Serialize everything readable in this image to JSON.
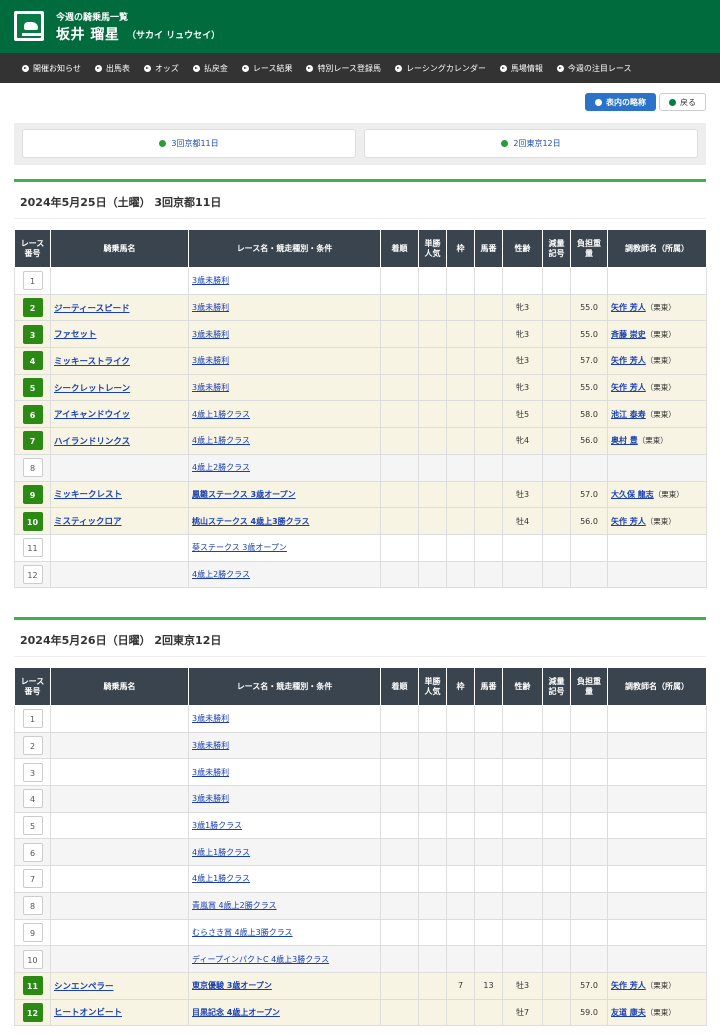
{
  "header": {
    "subtitle": "今週の騎乗馬一覧",
    "jockey_name": "坂井 瑠星",
    "jockey_kana": "（サカイ リュウセイ）"
  },
  "nav": [
    {
      "label": "開催お知らせ"
    },
    {
      "label": "出馬表"
    },
    {
      "label": "オッズ"
    },
    {
      "label": "払戻金"
    },
    {
      "label": "レース結果"
    },
    {
      "label": "特別レース登録馬"
    },
    {
      "label": "レーシングカレンダー"
    },
    {
      "label": "馬場情報"
    },
    {
      "label": "今週の注目レース"
    }
  ],
  "actions": {
    "abbr_label": "表内の略称",
    "back_label": "戻る"
  },
  "venues": [
    {
      "label": "3回京都11日"
    },
    {
      "label": "2回東京12日"
    }
  ],
  "columns": {
    "race_no": "レース番号",
    "horse": "騎乗馬名",
    "race": "レース名・競走種別・条件",
    "finish": "着順",
    "popularity": "単勝人気",
    "frame": "枠",
    "number": "馬番",
    "sexage": "性齢",
    "reduction": "減量記号",
    "weight": "負担重量",
    "trainer": "調教師名（所属）"
  },
  "days": [
    {
      "title": "2024年5月25日（土曜） 3回京都11日",
      "races": [
        {
          "no": "1",
          "horse": "",
          "race": "3歳未勝利",
          "finish": "",
          "pop": "",
          "frame": "",
          "num": "",
          "sexage": "",
          "red": "",
          "weight": "",
          "trainer": "",
          "aff": ""
        },
        {
          "no": "2",
          "horse": "ジーティースピード",
          "race": "3歳未勝利",
          "finish": "",
          "pop": "",
          "frame": "",
          "num": "",
          "sexage": "牝3",
          "red": "",
          "weight": "55.0",
          "trainer": "矢作 芳人",
          "aff": "（栗東）"
        },
        {
          "no": "3",
          "horse": "ファセット",
          "race": "3歳未勝利",
          "finish": "",
          "pop": "",
          "frame": "",
          "num": "",
          "sexage": "牝3",
          "red": "",
          "weight": "55.0",
          "trainer": "斉藤 崇史",
          "aff": "（栗東）"
        },
        {
          "no": "4",
          "horse": "ミッキーストライク",
          "race": "3歳未勝利",
          "finish": "",
          "pop": "",
          "frame": "",
          "num": "",
          "sexage": "牡3",
          "red": "",
          "weight": "57.0",
          "trainer": "矢作 芳人",
          "aff": "（栗東）"
        },
        {
          "no": "5",
          "horse": "シークレットレーン",
          "race": "3歳未勝利",
          "finish": "",
          "pop": "",
          "frame": "",
          "num": "",
          "sexage": "牝3",
          "red": "",
          "weight": "55.0",
          "trainer": "矢作 芳人",
          "aff": "（栗東）"
        },
        {
          "no": "6",
          "horse": "アイキャンドウイッ",
          "race": "4歳上1勝クラス",
          "finish": "",
          "pop": "",
          "frame": "",
          "num": "",
          "sexage": "牡5",
          "red": "",
          "weight": "58.0",
          "trainer": "池江 泰寿",
          "aff": "（栗東）"
        },
        {
          "no": "7",
          "horse": "ハイランドリンクス",
          "race": "4歳上1勝クラス",
          "finish": "",
          "pop": "",
          "frame": "",
          "num": "",
          "sexage": "牝4",
          "red": "",
          "weight": "56.0",
          "trainer": "奥村 豊",
          "aff": "（栗東）"
        },
        {
          "no": "8",
          "horse": "",
          "race": "4歳上2勝クラス",
          "finish": "",
          "pop": "",
          "frame": "",
          "num": "",
          "sexage": "",
          "red": "",
          "weight": "",
          "trainer": "",
          "aff": ""
        },
        {
          "no": "9",
          "horse": "ミッキークレスト",
          "race": "鳳雛ステークス 3歳オープン",
          "finish": "",
          "pop": "",
          "frame": "",
          "num": "",
          "sexage": "牡3",
          "red": "",
          "weight": "57.0",
          "trainer": "大久保 龍志",
          "aff": "（栗東）"
        },
        {
          "no": "10",
          "horse": "ミスティックロア",
          "race": "桃山ステークス 4歳上3勝クラス",
          "finish": "",
          "pop": "",
          "frame": "",
          "num": "",
          "sexage": "牡4",
          "red": "",
          "weight": "56.0",
          "trainer": "矢作 芳人",
          "aff": "（栗東）"
        },
        {
          "no": "11",
          "horse": "",
          "race": "葵ステークス 3歳オープン",
          "finish": "",
          "pop": "",
          "frame": "",
          "num": "",
          "sexage": "",
          "red": "",
          "weight": "",
          "trainer": "",
          "aff": ""
        },
        {
          "no": "12",
          "horse": "",
          "race": "4歳上2勝クラス",
          "finish": "",
          "pop": "",
          "frame": "",
          "num": "",
          "sexage": "",
          "red": "",
          "weight": "",
          "trainer": "",
          "aff": ""
        }
      ]
    },
    {
      "title": "2024年5月26日（日曜） 2回東京12日",
      "races": [
        {
          "no": "1",
          "horse": "",
          "race": "3歳未勝利",
          "finish": "",
          "pop": "",
          "frame": "",
          "num": "",
          "sexage": "",
          "red": "",
          "weight": "",
          "trainer": "",
          "aff": ""
        },
        {
          "no": "2",
          "horse": "",
          "race": "3歳未勝利",
          "finish": "",
          "pop": "",
          "frame": "",
          "num": "",
          "sexage": "",
          "red": "",
          "weight": "",
          "trainer": "",
          "aff": ""
        },
        {
          "no": "3",
          "horse": "",
          "race": "3歳未勝利",
          "finish": "",
          "pop": "",
          "frame": "",
          "num": "",
          "sexage": "",
          "red": "",
          "weight": "",
          "trainer": "",
          "aff": ""
        },
        {
          "no": "4",
          "horse": "",
          "race": "3歳未勝利",
          "finish": "",
          "pop": "",
          "frame": "",
          "num": "",
          "sexage": "",
          "red": "",
          "weight": "",
          "trainer": "",
          "aff": ""
        },
        {
          "no": "5",
          "horse": "",
          "race": "3歳1勝クラス",
          "finish": "",
          "pop": "",
          "frame": "",
          "num": "",
          "sexage": "",
          "red": "",
          "weight": "",
          "trainer": "",
          "aff": ""
        },
        {
          "no": "6",
          "horse": "",
          "race": "4歳上1勝クラス",
          "finish": "",
          "pop": "",
          "frame": "",
          "num": "",
          "sexage": "",
          "red": "",
          "weight": "",
          "trainer": "",
          "aff": ""
        },
        {
          "no": "7",
          "horse": "",
          "race": "4歳上1勝クラス",
          "finish": "",
          "pop": "",
          "frame": "",
          "num": "",
          "sexage": "",
          "red": "",
          "weight": "",
          "trainer": "",
          "aff": ""
        },
        {
          "no": "8",
          "horse": "",
          "race": "青嵐賞 4歳上2勝クラス",
          "finish": "",
          "pop": "",
          "frame": "",
          "num": "",
          "sexage": "",
          "red": "",
          "weight": "",
          "trainer": "",
          "aff": ""
        },
        {
          "no": "9",
          "horse": "",
          "race": "むらさき賞 4歳上3勝クラス",
          "finish": "",
          "pop": "",
          "frame": "",
          "num": "",
          "sexage": "",
          "red": "",
          "weight": "",
          "trainer": "",
          "aff": ""
        },
        {
          "no": "10",
          "horse": "",
          "race": "ディープインパクトC 4歳上3勝クラス",
          "finish": "",
          "pop": "",
          "frame": "",
          "num": "",
          "sexage": "",
          "red": "",
          "weight": "",
          "trainer": "",
          "aff": ""
        },
        {
          "no": "11",
          "horse": "シンエンペラー",
          "race": "東京優駿 3歳オープン",
          "finish": "",
          "pop": "",
          "frame": "7",
          "num": "13",
          "sexage": "牡3",
          "red": "",
          "weight": "57.0",
          "trainer": "矢作 芳人",
          "aff": "（栗東）"
        },
        {
          "no": "12",
          "horse": "ヒートオンビート",
          "race": "目黒記念 4歳上オープン",
          "finish": "",
          "pop": "",
          "frame": "",
          "num": "",
          "sexage": "牡7",
          "red": "",
          "weight": "59.0",
          "trainer": "友道 康夫",
          "aff": "（栗東）"
        }
      ]
    }
  ]
}
